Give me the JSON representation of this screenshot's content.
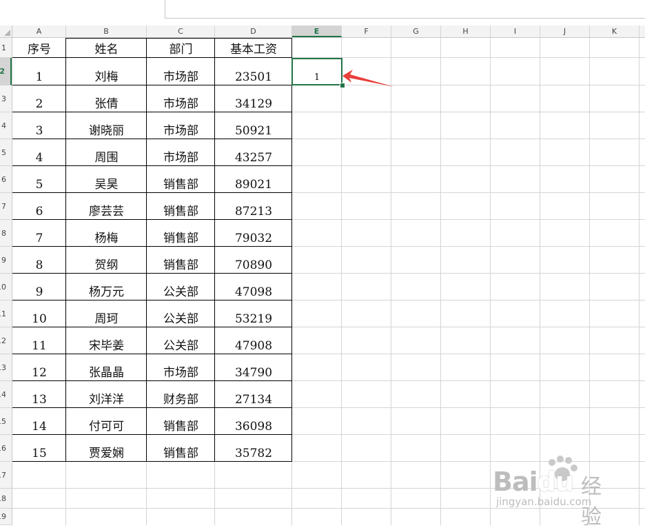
{
  "columns": [
    "A",
    "B",
    "C",
    "D",
    "E",
    "F",
    "G",
    "H",
    "I",
    "J",
    "K"
  ],
  "selected_column": "E",
  "rows": [
    "1",
    "2",
    "3",
    "4",
    "5",
    "6",
    "7",
    "8",
    "9",
    "10",
    "11",
    "12",
    "13",
    "14",
    "15",
    "16",
    "17",
    "18",
    "19"
  ],
  "selected_row": "2",
  "table": {
    "headers": [
      "序号",
      "姓名",
      "部门",
      "基本工资"
    ],
    "records": [
      [
        "1",
        "刘梅",
        "市场部",
        "23501"
      ],
      [
        "2",
        "张倩",
        "市场部",
        "34129"
      ],
      [
        "3",
        "谢晓丽",
        "市场部",
        "50921"
      ],
      [
        "4",
        "周围",
        "市场部",
        "43257"
      ],
      [
        "5",
        "吴昊",
        "销售部",
        "89021"
      ],
      [
        "6",
        "廖芸芸",
        "销售部",
        "87213"
      ],
      [
        "7",
        "杨梅",
        "销售部",
        "79032"
      ],
      [
        "8",
        "贺纲",
        "销售部",
        "70890"
      ],
      [
        "9",
        "杨万元",
        "公关部",
        "47098"
      ],
      [
        "10",
        "周珂",
        "公关部",
        "53219"
      ],
      [
        "11",
        "宋毕姜",
        "公关部",
        "47908"
      ],
      [
        "12",
        "张晶晶",
        "市场部",
        "34790"
      ],
      [
        "13",
        "刘洋洋",
        "财务部",
        "27134"
      ],
      [
        "14",
        "付可可",
        "销售部",
        "36098"
      ],
      [
        "15",
        "贾爱娴",
        "销售部",
        "35782"
      ]
    ]
  },
  "active_cell": {
    "ref": "E2",
    "value": "1"
  },
  "watermark": {
    "brand": "Bai",
    "brand2": "du",
    "cn": "经验",
    "url": "jingyan.baidu.com"
  },
  "colors": {
    "accent": "#217346",
    "arrow": "#e8403a",
    "gridline": "#d4d4d4"
  }
}
